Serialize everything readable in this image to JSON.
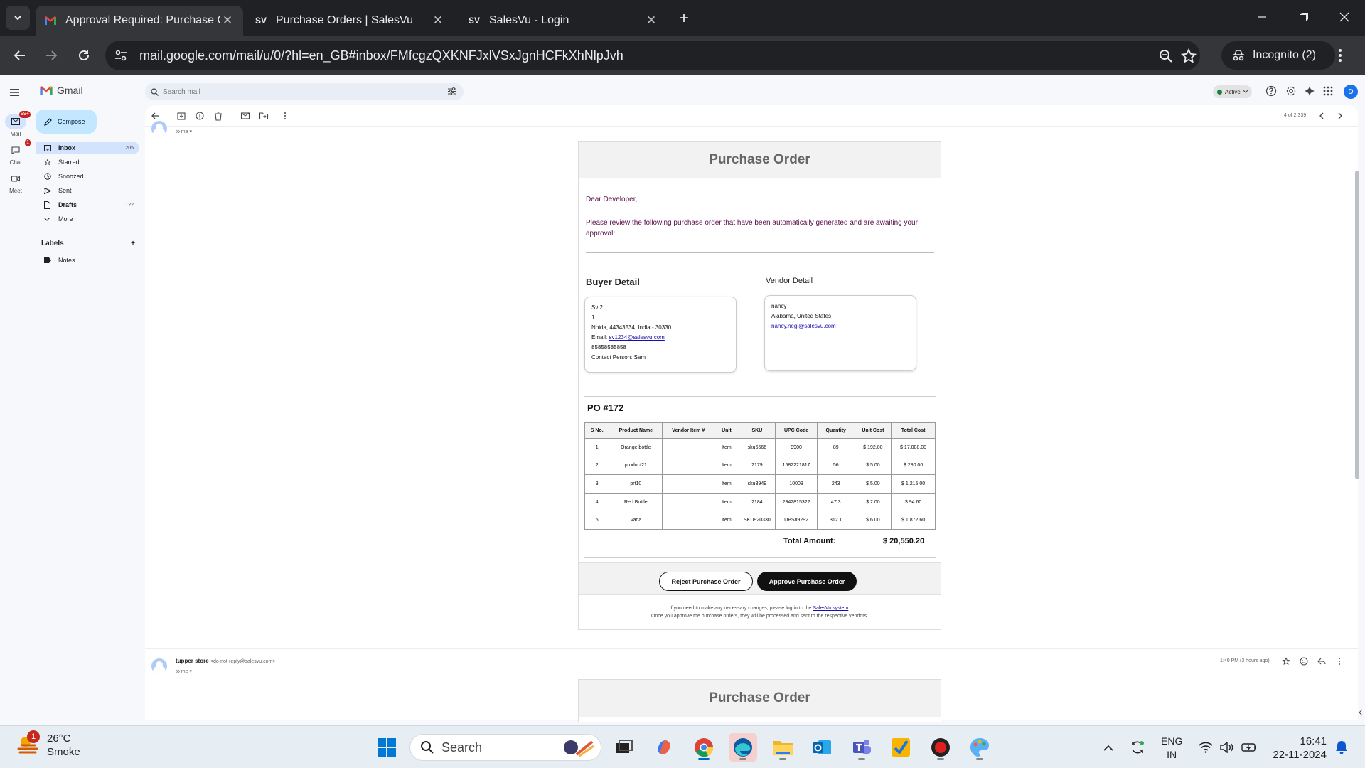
{
  "browser": {
    "tabs": [
      {
        "title": "Approval Required: Purchase Or",
        "favicon": "gmail-icon",
        "active": true
      },
      {
        "title": "Purchase Orders | SalesVu",
        "favicon": "SV",
        "active": false
      },
      {
        "title": "SalesVu - Login",
        "favicon": "SV",
        "active": false
      }
    ],
    "url": "mail.google.com/mail/u/0/?hl=en_GB#inbox/FMfcgzQXKNFJxlVSxJgnHCFkXhNlpJvh",
    "incognito_label": "Incognito (2)"
  },
  "gmail": {
    "brand": "Gmail",
    "search_placeholder": "Search mail",
    "status": "Active",
    "avatar_letter": "D",
    "rail": [
      {
        "label": "Mail",
        "badge": "99+"
      },
      {
        "label": "Chat",
        "badge": "1"
      },
      {
        "label": "Meet",
        "badge": ""
      }
    ],
    "compose": "Compose",
    "nav": [
      {
        "label": "Inbox",
        "count": "205"
      },
      {
        "label": "Starred",
        "count": ""
      },
      {
        "label": "Snoozed",
        "count": ""
      },
      {
        "label": "Sent",
        "count": ""
      },
      {
        "label": "Drafts",
        "count": "122"
      },
      {
        "label": "More",
        "count": ""
      }
    ],
    "labels_heading": "Labels",
    "labels": [
      "Notes"
    ],
    "pagination": "4 of 2,339",
    "to_me": "to me"
  },
  "email": {
    "title": "Purchase Order",
    "greeting": "Dear Developer,",
    "intro": "Please review the following purchase order that have been automatically generated and are awaiting your approval:",
    "buyer": {
      "heading": "Buyer Detail",
      "name": "Sv 2",
      "line2": "1",
      "address": "Noida, 44343534, India - 30330",
      "email_label": "Email: ",
      "email": "sv1234@salesvu.com",
      "phone": "85858585858",
      "contact": "Contact Person: Sam"
    },
    "vendor": {
      "heading": "Vendor Detail",
      "name": "nancy",
      "address": "Alabama, United States",
      "email": "nancy.negi@salesvu.com"
    },
    "po_number": "PO #172",
    "columns": [
      "S No.",
      "Product Name",
      "Vendor Item #",
      "Unit",
      "SKU",
      "UPC Code",
      "Quantity",
      "Unit Cost",
      "Total Cost"
    ],
    "rows": [
      [
        "1",
        "Orange bottle",
        "",
        "Item",
        "sku6566",
        "9900",
        "89",
        "$ 192.00",
        "$ 17,088.00"
      ],
      [
        "2",
        "product21",
        "",
        "Item",
        "2179",
        "1582221817",
        "56",
        "$ 5.00",
        "$ 280.00"
      ],
      [
        "3",
        "prt10",
        "",
        "Item",
        "sku3949",
        "10003",
        "243",
        "$ 5.00",
        "$ 1,215.00"
      ],
      [
        "4",
        "Red Bottle",
        "",
        "Item",
        "2184",
        "2342815322",
        "47.3",
        "$ 2.00",
        "$ 94.60"
      ],
      [
        "5",
        "Vada",
        "",
        "Item",
        "SKU920330",
        "UPS89292",
        "312.1",
        "$ 6.00",
        "$ 1,872.60"
      ]
    ],
    "total_label": "Total Amount:",
    "total_value": "$ 20,550.20",
    "reject_label": "Reject Purchase Order",
    "approve_label": "Approve Purchase Order",
    "footer_line1_pre": "If you need to make any necessary changes, please log in to the ",
    "footer_link": "SalesVu system",
    "footer_line1_post": ".",
    "footer_line2": "Once you approve the purchase orders, they will be processed and sent to the respective vendors."
  },
  "next_message": {
    "sender": "tupper store",
    "sender_email": "<do-not-reply@salesvu.com>",
    "time": "1:40 PM (3 hours ago)",
    "to_me": "to me",
    "title": "Purchase Order"
  },
  "taskbar": {
    "temperature": "26°C",
    "weather": "Smoke",
    "weather_badge": "1",
    "search": "Search",
    "lang_top": "ENG",
    "lang_bottom": "IN",
    "time": "16:41",
    "date": "22-11-2024"
  }
}
